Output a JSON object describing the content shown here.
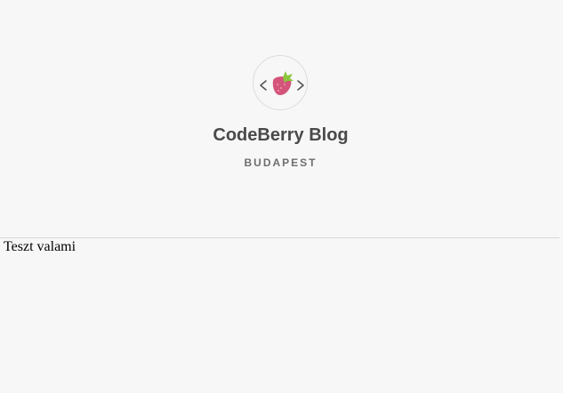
{
  "header": {
    "logo_icon": "codeberry-strawberry-code-icon",
    "title": "CodeBerry Blog",
    "subtitle": "BUDAPEST"
  },
  "main": {
    "text": "Teszt valami"
  },
  "colors": {
    "background": "#f7f7f7",
    "title": "#4a4a4a",
    "subtitle": "#6e6e6e",
    "strawberry": "#d4547a",
    "leaf": "#8cc63f"
  }
}
